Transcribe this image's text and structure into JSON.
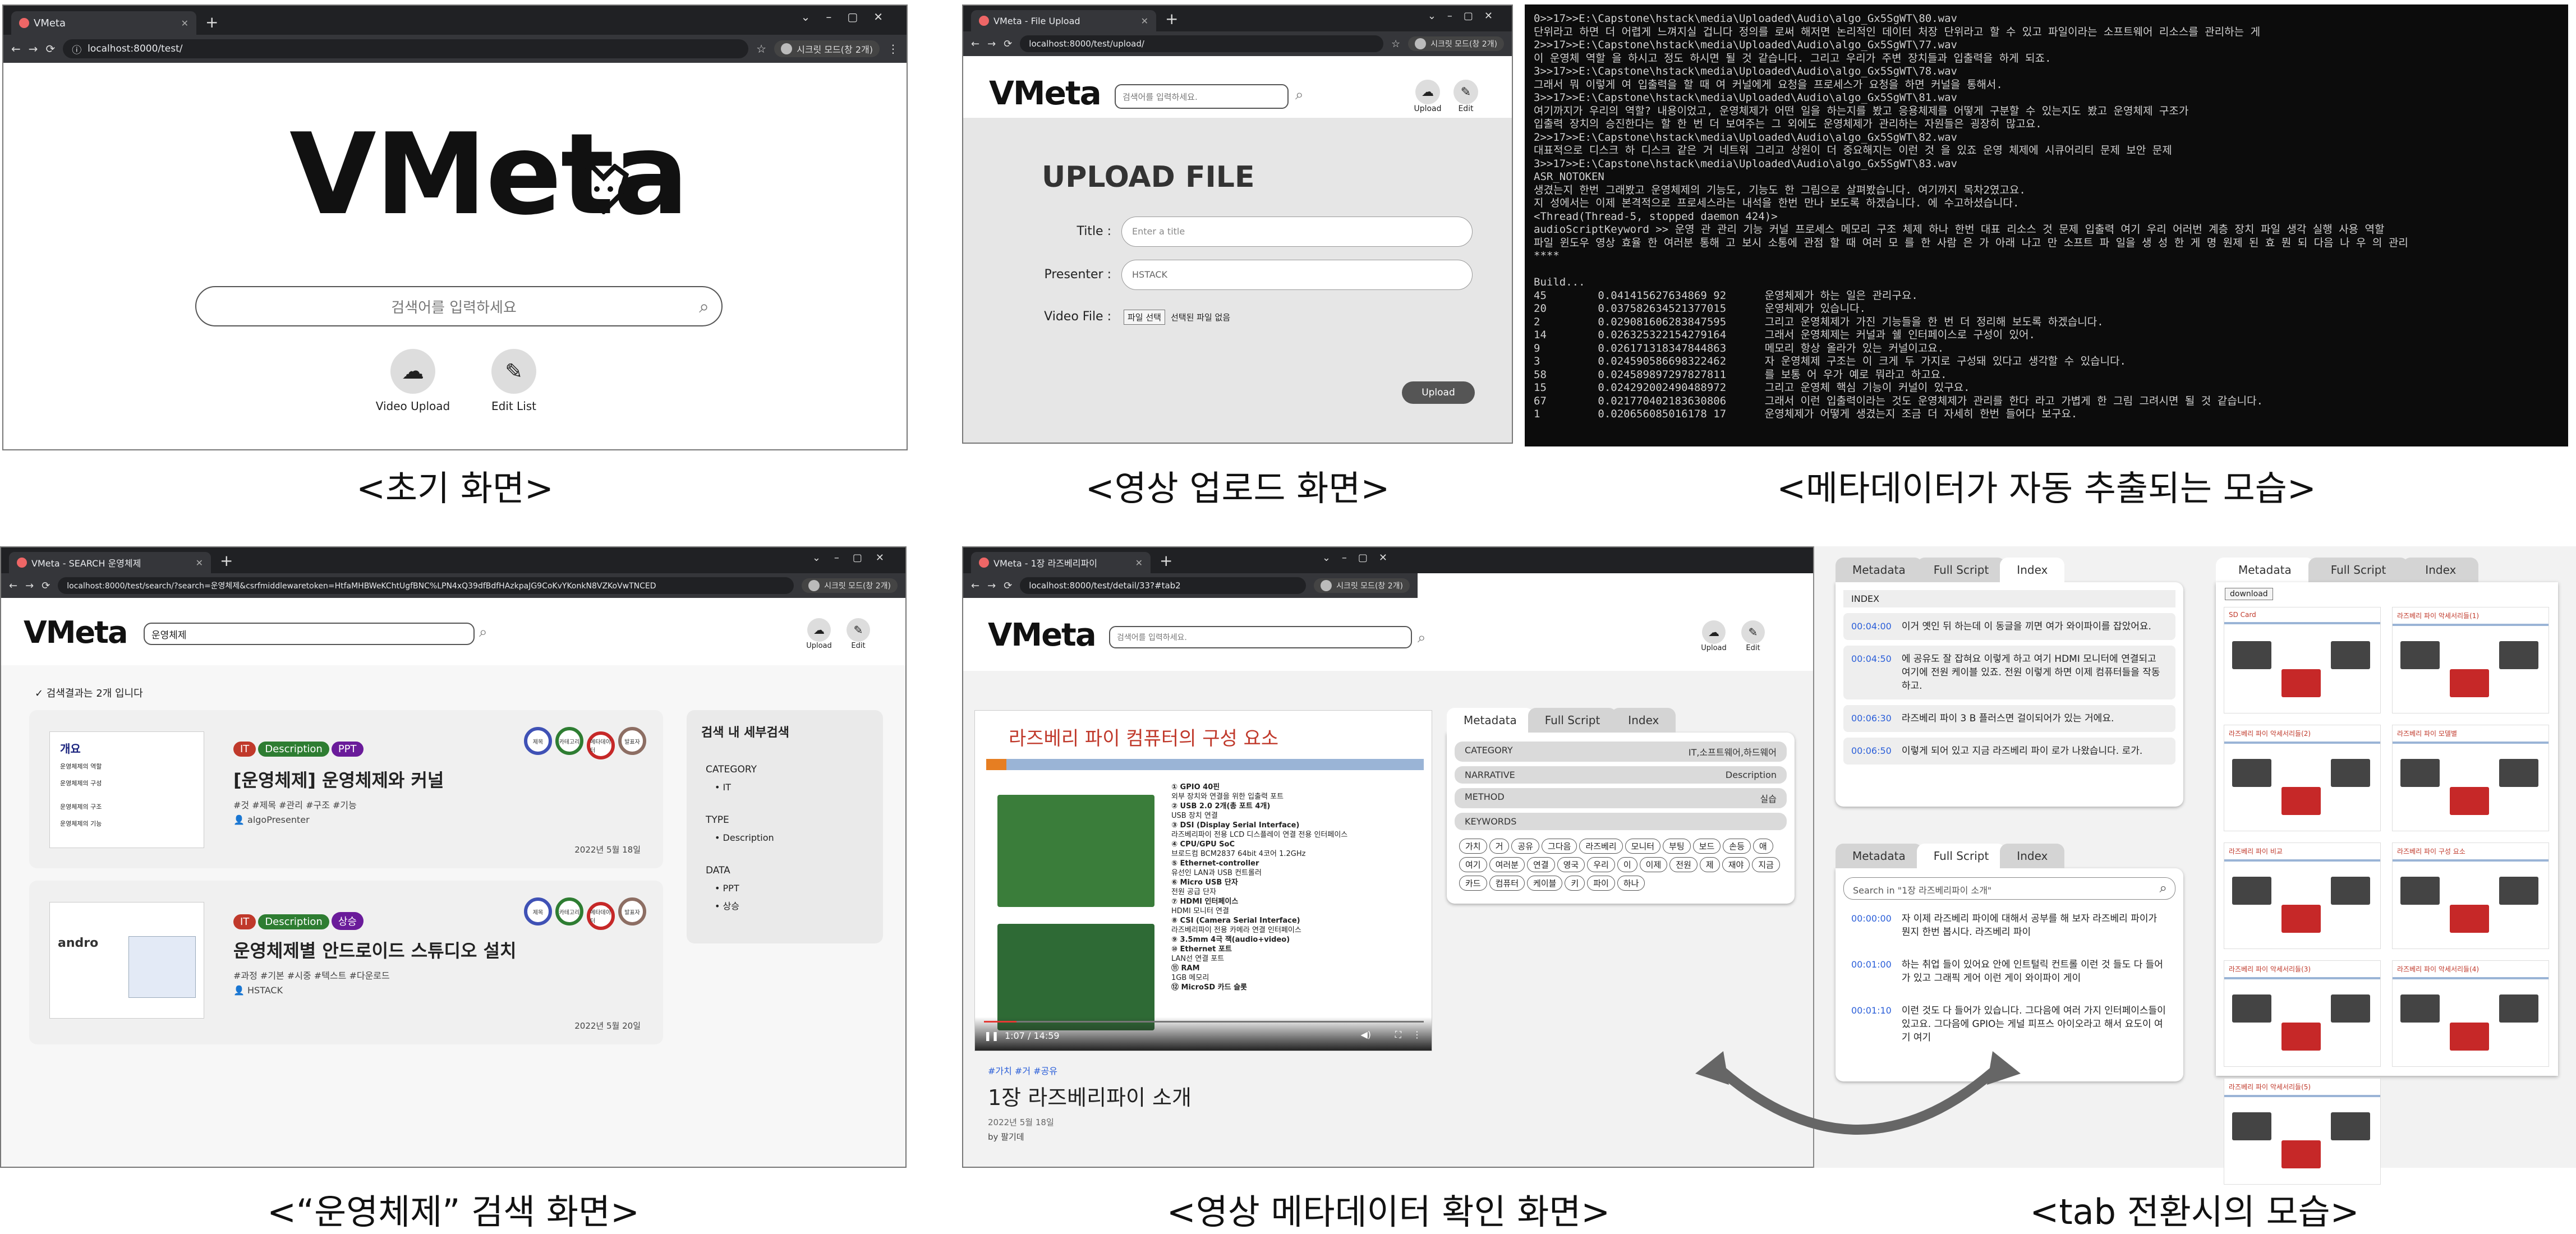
{
  "colors": {
    "accent_red": "#b71c1c",
    "chip_it": "#c0392b",
    "chip_description": "#2e7d32",
    "chip_ppt": "#6a1b9a",
    "chip_ssang": "#6a1b9a",
    "link_blue": "#2b5fd9",
    "dark_button": "#555555"
  },
  "p1": {
    "tab_title": "VMeta",
    "url": "localhost:8000/test/",
    "profile": "시크릿 모드(창 2개)",
    "logo": "VMeta",
    "search_placeholder": "검색어를 입력하세요",
    "btn_upload": "Video Upload",
    "btn_edit": "Edit List",
    "caption": "<초기 화면>"
  },
  "p2": {
    "tab_title": "VMeta - File Upload",
    "url": "localhost:8000/test/upload/",
    "profile": "시크릿 모드(창 2개)",
    "logo": "VMeta",
    "search_placeholder": "검색어를 입력하세요.",
    "upload": "Upload",
    "edit": "Edit",
    "heading": "UPLOAD FILE",
    "title_label": "Title :",
    "title_placeholder": "Enter a title",
    "presenter_label": "Presenter :",
    "presenter_value": "HSTACK",
    "file_label": "Video File :",
    "file_button": "파일 선택",
    "file_none": "선택된 파일 없음",
    "submit": "Upload",
    "caption": "<영상 업로드 화면>"
  },
  "p3": {
    "lines": [
      "0>>17>>E:\\Capstone\\hstack\\media\\Uploaded\\Audio\\algo_Gx5SgWT\\80.wav",
      "단위라고 하면 더 어렵게 느껴지실 겁니다 정의를 로써 해저면 논리적인 데이터 처장 단위라고 할 수 있고 파일이라는 소프트웨어 리소스를 관리하는 게",
      "2>>17>>E:\\Capstone\\hstack\\media\\Uploaded\\Audio\\algo_Gx5SgWT\\77.wav",
      "이 운영체 역할 을 하시고 정도 하시면 될 것 같습니다. 그리고 우리가 주변 장치들과 입출력을 하게 되죠.",
      "3>>17>>E:\\Capstone\\hstack\\media\\Uploaded\\Audio\\algo_Gx5SgWT\\78.wav",
      "그래서 뭐 이렇게 여 입출력을 할 때 여 커널에게 요청을 프로세스가 요청을 하면 커널을 통해서.",
      "3>>17>>E:\\Capstone\\hstack\\media\\Uploaded\\Audio\\algo_Gx5SgWT\\81.wav",
      "여기까지가 우리의 역할? 내용이었고, 운영체제가 어떤 일을 하는지를 봤고 응용체제를 어떻게 구분할 수 있는지도 봤고 운영체제 구조가",
      "입출력 장치의 승진한다는 할 한 번 더 보여주는 그 외에도 운영체제가 관리하는 자원들은 굉장히 많고요.",
      "2>>17>>E:\\Capstone\\hstack\\media\\Uploaded\\Audio\\algo_Gx5SgWT\\82.wav",
      "대표적으로 디스크 하 디스크 같은 거 네트워 그리고 상원이 더 중요해지는 이런 것 을 있죠 운영 체제에 시큐어리티 문제 보안 문제",
      "3>>17>>E:\\Capstone\\hstack\\media\\Uploaded\\Audio\\algo_Gx5SgWT\\83.wav",
      "ASR_NOTOKEN",
      "생겼는지 한번 그래봤고 운영체제의 기능도, 기능도 한 그림으로 살펴봤습니다. 여기까지 목차2였고요.",
      "지 성에서는 이제 본격적으로 프로세스라는 내석을 한번 만나 보도록 하겠습니다. 에 수고하셨습니다.",
      "<Thread(Thread-5, stopped daemon 424)>",
      "audioScriptKeyword >> 운영 관 관리 기능 커널 프로세스 메모리 구조 체제 하나 한번 대표 리소스 것 문제 입출력 여기 우리 어러번 계층 장치 파일 생각 실행 사용 역할",
      "파일 윈도우 영상 효율 한 여러분 통해 고 보시 소통에 관점 할 때 여러 모 를 한 사람 은 가 아래 나고 만 소프트 파 일을 생 성 한 게 명 원제 된 효 뭔 되 다음 나 우 의 관리",
      "****",
      "",
      "Build...",
      "45        0.041415627634869 92      운영체제가 하는 일은 관리구요.",
      "20        0.037582634521377015      운영체제가 있습니다.",
      "2         0.029081606283847595      그리고 운영체제가 가진 기능들을 한 번 더 정리해 보도록 하겠습니다.",
      "14        0.026325322154279164      그래서 운영체제는 커널과 쉘 인터페이스로 구성이 있어.",
      "9         0.026171318347844863      메모리 항상 올라가 있는 커널이고요.",
      "3         0.024590586698322462      자 운영체제 구조는 이 크게 두 가지로 구성돼 있다고 생각할 수 있습니다.",
      "58        0.024589897297827811      를 보통 어 우가 예로 뭐라고 하고요.",
      "15        0.024292002490488972      그리고 운영체 핵심 기능이 커널이 있구요.",
      "67        0.021770402183630806      그래서 이런 입출력이라는 것도 운영체제가 관리를 한다 라고 가볍게 한 그림 그려시면 될 것 같습니다.",
      "1         0.020656085016178 17      운영체제가 어떻게 생겼는지 조금 더 자세히 한번 들어다 보구요."
    ],
    "caption": "<메타데이터가 자동 추출되는 모습>"
  },
  "p4": {
    "tab_title": "VMeta - SEARCH 운영체제",
    "url": "localhost:8000/test/search/?search=운영체제&csrfmiddlewaretoken=HtfaMHBWeKChtUgfBNC%LPN4xQ39dfBdfHAzkpaJG9CoKvYKonkN8VZKoVwTNCED",
    "profile": "시크릿 모드(창 2개)",
    "logo": "VMeta",
    "search_value": "운영체제",
    "upload": "Upload",
    "edit": "Edit",
    "result_count": "✓ 검색결과는 2개 입니다",
    "rings": [
      "제목",
      "카테고리",
      "메타데이터",
      "발표자"
    ],
    "results": [
      {
        "tags": [
          "IT",
          "Description",
          "PPT"
        ],
        "title": "[운영체제] 운영체제와 커널",
        "keywords": "#것 #제목 #관리 #구조 #기능",
        "presenter": "algoPresenter",
        "date": "2022년 5월 18일",
        "thumb_title": "개요",
        "thumb_lines": [
          "운영체제의 역할",
          "운영체제의 구성",
          "운영체제의 구조",
          "운영체제의 기능"
        ]
      },
      {
        "tags": [
          "IT",
          "Description",
          "상승"
        ],
        "title": "운영체제별 안드로이드 스튜디오 설치",
        "keywords": "#과정 #기본 #시중 #텍스트 #다운로드",
        "presenter": "HSTACK",
        "date": "2022년 5월 20일",
        "thumb_title": "andro",
        "thumb_lines": []
      }
    ],
    "facet_title": "검색 내 세부검색",
    "facets": [
      {
        "name": "CATEGORY",
        "values": [
          "IT"
        ]
      },
      {
        "name": "TYPE",
        "values": [
          "Description"
        ]
      },
      {
        "name": "DATA",
        "values": [
          "PPT",
          "상승"
        ]
      }
    ],
    "caption": "<“운영체제” 검색 화면>"
  },
  "p5": {
    "tab_title": "VMeta - 1장 라즈베리파이",
    "url": "localhost:8000/test/detail/33?#tab2",
    "profile": "시크릿 모드(창 2개)",
    "logo": "VMeta",
    "search_placeholder": "검색어를 입력하세요.",
    "upload": "Upload",
    "edit": "Edit",
    "slide_title": "라즈베리 파이 컴퓨터의 구성 요소",
    "slide_items": [
      "① GPIO 40핀",
      "외부 장치와 연결을 위한 입출력 포트",
      "② USB 2.0 2개(총 포트 4개)",
      "USB 장치 연결",
      "③ DSI (Display Serial Interface)",
      "라즈베리파이 전용 LCD 디스플레이 연결 전용 인터페이스",
      "④ CPU/GPU SoC",
      "브로드컴 BCM2837 64bit 4코어 1.2GHz",
      "⑤ Ethernet-controller",
      "유선인 LAN과 USB 컨트롤러",
      "⑥ Micro USB 단자",
      "전원 공급 단자",
      "⑦ HDMI 인터페이스",
      "HDMI 모니터 연결",
      "⑧ CSI (Camera Serial Interface)",
      "라즈베리파이 전용 카메라 연결 인터페이스",
      "⑨ 3.5mm 4극 잭(audio+video)",
      "⑩ Ethernet 포트",
      "LAN선 연결 포트",
      "⑪ RAM",
      "1GB 메모리",
      "⑫ MicroSD 카드 슬롯"
    ],
    "time": "1:07 / 14:59",
    "hashtags": "#가치 #거 #공유",
    "video_title": "1장 라즈베리파이 소개",
    "date": "2022년 5월 18일",
    "by": "by 팔기데",
    "tabs": [
      "Metadata",
      "Full Script",
      "Index"
    ],
    "meta_rows": [
      {
        "k": "CATEGORY",
        "v": "IT,소프트웨어,하드웨어"
      },
      {
        "k": "NARRATIVE",
        "v": "Description"
      },
      {
        "k": "METHOD",
        "v": "실습"
      },
      {
        "k": "KEYWORDS",
        "v": ""
      }
    ],
    "keywords": [
      "가치",
      "거",
      "공유",
      "그다음",
      "라즈베리",
      "모니터",
      "부팅",
      "보드",
      "손등",
      "애",
      "여기",
      "여러분",
      "연결",
      "영국",
      "우리",
      "이",
      "이제",
      "전원",
      "제",
      "재야",
      "지금",
      "카드",
      "컴퓨터",
      "케이블",
      "키",
      "파이",
      "하나"
    ],
    "caption": "<영상 메타데이터 확인 화면>"
  },
  "p6": {
    "tabs": [
      "Metadata",
      "Full Script",
      "Index"
    ],
    "index_header": "INDEX",
    "index_rows": [
      {
        "t": "00:04:00",
        "text": "이거 옛인 뒤 하는데 이 동글을 끼면 여가 와이파이를 잡았어요."
      },
      {
        "t": "00:04:50",
        "text": "에 공유도 잘 잡혀요 이렇게 하고 여기 HDMI 모니터에 연결되고 여기에 전원 케이블 있죠. 전원 이렇게 하면 이제 컴퓨터들을 작동하고."
      },
      {
        "t": "00:06:30",
        "text": "라즈베리 파이 3 B 플러스면 걸이되어가 있는 거에요."
      },
      {
        "t": "00:06:50",
        "text": "이렇게 되어 있고 지금 라즈베리 파이 로가 나왔습니다. 로가."
      }
    ],
    "script_search": "Search in \"1장 라즈베리파이 소개\"",
    "script_rows": [
      {
        "t": "00:00:00",
        "text": "자 이제 라즈베리 파이에 대해서 공부를 해 보자 라즈베리 파이가 뭔지 한번 봅시다. 라즈베리 파이"
      },
      {
        "t": "00:01:00",
        "text": "하는 취업 들이 있어요 안에 인트털릭 컨트롤 이런 것 들도 다 들어가 있고 그래픽 게어 이런 게이 와이파이 게이"
      },
      {
        "t": "00:01:10",
        "text": "이런 것도 다 들어가 있습니다. 그다음에 여러 가지 인터페이스들이 있고요. 그다음에 GPIO는 게널 피프스 아이오라고 해서 요도이 여기 여기"
      }
    ],
    "download": "download",
    "slide_heads": [
      "SD Card",
      "라즈베리 파이 악세서리들(1)",
      "라즈베리 파이 악세서리들(2)",
      "라즈베리 파이 모델별",
      "라즈베리 파이 비교",
      "라즈베리 파이 구성 요소",
      "라즈베리 파이 악세서리들(3)",
      "라즈베리 파이 악세서리들(4)",
      "라즈베리 파이 악세서리들(5)"
    ],
    "caption": "<tab 전환시의 모습>"
  }
}
